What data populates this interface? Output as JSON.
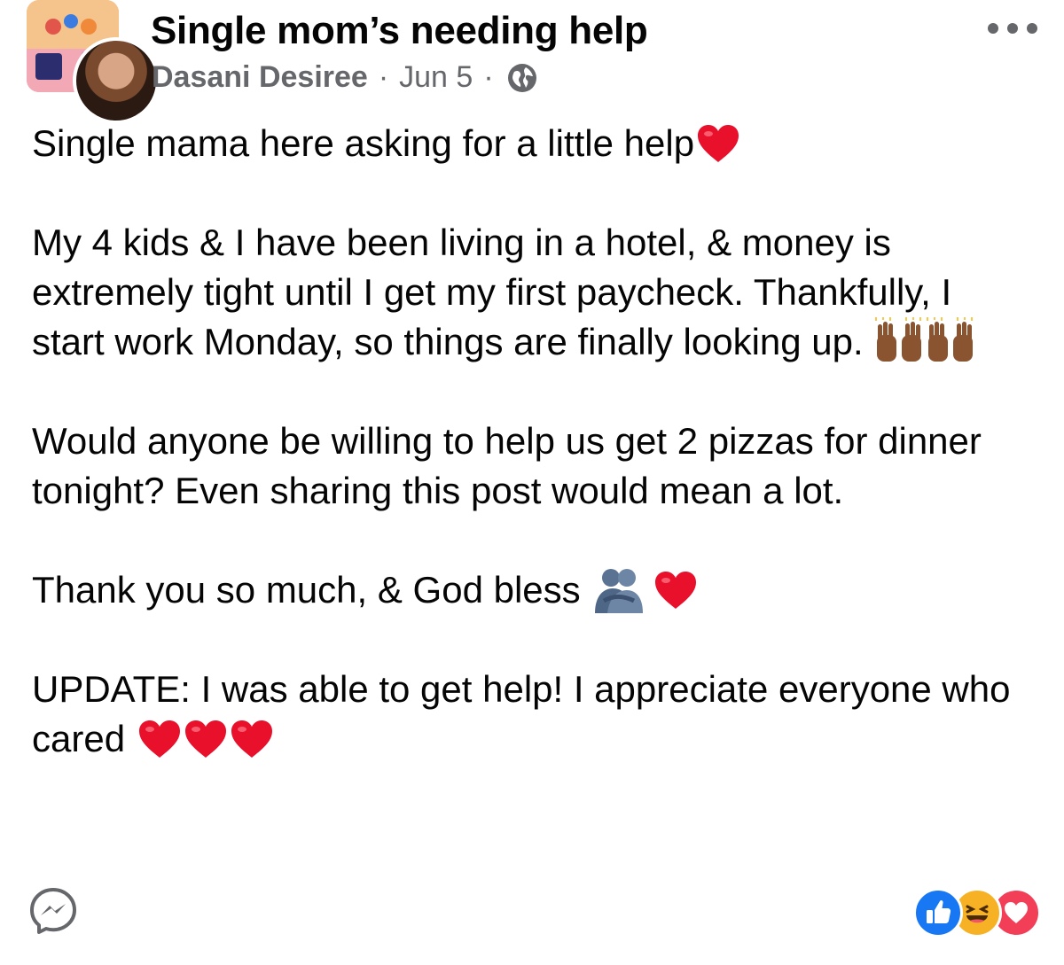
{
  "post": {
    "group_name": "Single mom’s needing help",
    "author": "Dasani Desiree",
    "separator": "·",
    "date": "Jun 5",
    "audience_icon": "globe-icon",
    "more_icon": "more-options-icon",
    "paragraphs": {
      "p1": "Single mama here asking for a little help",
      "p2": "My 4 kids & I have been living in a hotel, & money is extremely tight until I get my first paycheck. Thankfully, I start work Monday, so things are finally looking up. ",
      "p3": "Would anyone be willing to help us get 2 pizzas for dinner tonight? Even sharing this post would mean a lot.",
      "p4": "Thank you so much, & God bless",
      "p5": "UPDATE: I was able to get help! I appreciate everyone who cared "
    },
    "emojis": {
      "heart": "red-heart",
      "raised_hands": "raising-hands",
      "hug": "people-hugging"
    }
  },
  "footer": {
    "messenger_icon": "messenger-icon",
    "reactions": [
      "like",
      "haha",
      "love"
    ]
  },
  "colors": {
    "text": "#050505",
    "secondary": "#65676b",
    "like": "#1877f2",
    "haha": "#f7b125",
    "love": "#f33e58",
    "heart": "#e8102b"
  }
}
